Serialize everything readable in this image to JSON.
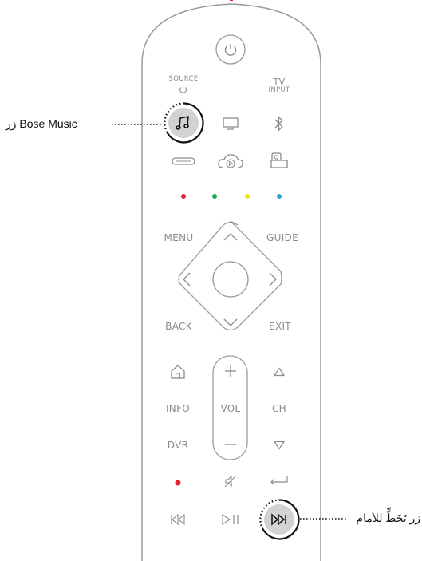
{
  "callouts": {
    "bose_music": "زر Bose Music",
    "skip_forward": "زر تَخَطٍّ للأمام"
  },
  "labels": {
    "source_line1": "SOURCE",
    "tv_line1": "TV",
    "tv_line2": "INPUT",
    "menu": "MENU",
    "guide": "GUIDE",
    "back": "BACK",
    "exit": "EXIT",
    "info": "INFO",
    "vol": "VOL",
    "ch": "CH",
    "dvr": "DVR"
  },
  "colors": {
    "outline": "#9a9a9a",
    "icon": "#8c8c8c",
    "highlight_fill": "#d2d2d2",
    "red": "#e3232c",
    "green": "#1aa84a",
    "yellow": "#f2df1e",
    "blue": "#2aa2d8"
  },
  "icons": [
    "power-icon",
    "source-icon",
    "music-note-icon",
    "tv-icon",
    "bluetooth-icon",
    "soundbar-icon",
    "cloud-play-icon",
    "game-console-icon",
    "home-icon",
    "triangle-up-icon",
    "triangle-down-icon",
    "plus-icon",
    "minus-icon",
    "mute-icon",
    "return-icon",
    "skip-back-icon",
    "play-pause-icon",
    "skip-forward-icon"
  ]
}
